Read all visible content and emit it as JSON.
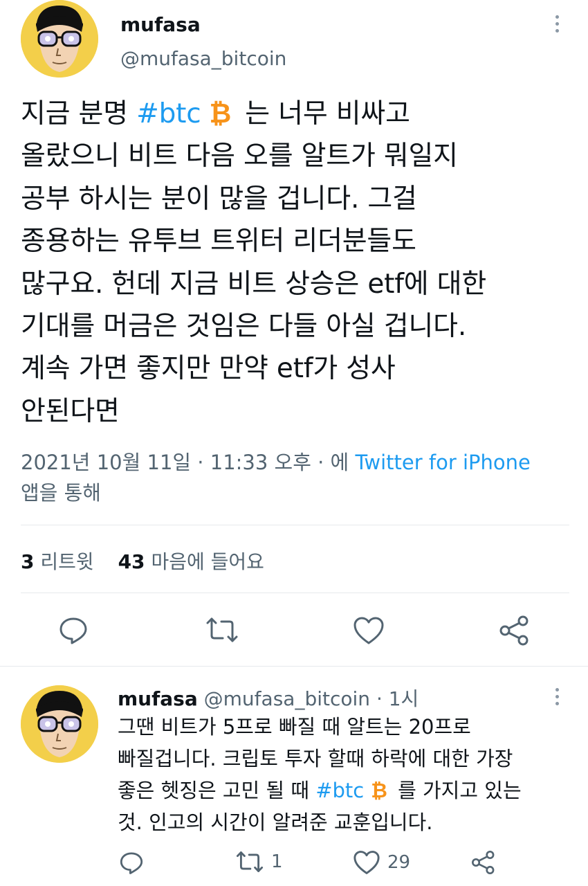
{
  "main_tweet": {
    "author_name": "mufasa",
    "author_handle": "@mufasa_bitcoin",
    "lines": [
      {
        "pre": "지금 분명 ",
        "tag": "#btc",
        "post": " 는 너무 비싸고"
      },
      {
        "text": "올랐으니 비트 다음 오를 알트가 뭐일지"
      },
      {
        "text": "공부 하시는 분이 많을 겁니다. 그걸"
      },
      {
        "text": "종용하는 유투브 트위터 리더분들도"
      },
      {
        "text": "많구요. 헌데 지금 비트 상승은 etf에 대한"
      },
      {
        "text": "기대를 머금은 것임은 다들 아실 겁니다."
      },
      {
        "text": "계속 가면 좋지만 만약 etf가 성사"
      },
      {
        "text": "안된다면"
      }
    ],
    "btc_symbol": "₿",
    "timestamp": "2021년 10월 11일 · 11:33 오후 · 에",
    "source_app": "Twitter for iPhone",
    "via_text": "앱을 통해",
    "retweet_count": "3",
    "retweet_label": "리트윗",
    "like_count": "43",
    "like_label": "마음에 들어요"
  },
  "reply_tweet": {
    "author_name": "mufasa",
    "author_handle": "@mufasa_bitcoin",
    "age": "· 1시",
    "lines": [
      {
        "text": "그땐 비트가 5프로 빠질 때 알트는 20프로"
      },
      {
        "text": "빠질겁니다. 크립토 투자 할때 하락에 대한 가장"
      },
      {
        "pre": "좋은 헷징은 고민 될 때 ",
        "tag": "#btc",
        "post": " 를  가지고 있는"
      },
      {
        "text": "것. 인고의 시간이 알려준 교훈입니다."
      }
    ],
    "retweet_count": "1",
    "like_count": "29"
  },
  "colors": {
    "accent": "#1d9bf0",
    "secondary_text": "#536471",
    "bitcoin": "#f7931a",
    "avatar_bg": "#f3cf4a"
  },
  "icons": {
    "reply": "speech-bubble",
    "retweet": "retweet-arrows",
    "like": "heart",
    "share": "share-nodes",
    "more": "vertical-ellipsis"
  }
}
